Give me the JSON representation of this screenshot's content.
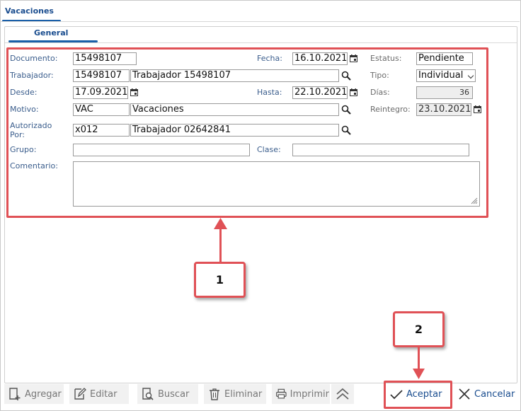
{
  "window": {
    "tab": "Vacaciones"
  },
  "form": {
    "subtab": "General",
    "labels": {
      "documento": "Documento:",
      "fecha": "Fecha:",
      "estatus": "Estatus:",
      "trabajador": "Trabajador:",
      "tipo": "Tipo:",
      "desde": "Desde:",
      "hasta": "Hasta:",
      "dias": "Días:",
      "motivo": "Motivo:",
      "reintegro": "Reintegro:",
      "autorizado_line1": "Autorizado",
      "autorizado_line2": "Por:",
      "grupo": "Grupo:",
      "clase": "Clase:",
      "comentario": "Comentario:"
    },
    "values": {
      "documento": "15498107",
      "fecha": "16.10.2021",
      "estatus": "Pendiente",
      "trabajador_code": "15498107",
      "trabajador_name": "Trabajador 15498107",
      "tipo": "Individual",
      "desde": "17.09.2021",
      "hasta": "22.10.2021",
      "dias": "36",
      "motivo_code": "VAC",
      "motivo_name": "Vacaciones",
      "reintegro": "23.10.2021",
      "autorizado_code": "x012",
      "autorizado_name": "Trabajador 02642841",
      "grupo": "",
      "clase": "",
      "comentario": ""
    }
  },
  "toolbar": {
    "agregar": "Agregar",
    "editar": "Editar",
    "buscar": "Buscar",
    "eliminar": "Eliminar",
    "imprimir": "Imprimir",
    "aceptar": "Aceptar",
    "cancelar": "Cancelar"
  },
  "annotations": {
    "callout1": "1",
    "callout2": "2"
  },
  "colors": {
    "highlight": "#e05156",
    "accent": "#1a5fa8"
  }
}
